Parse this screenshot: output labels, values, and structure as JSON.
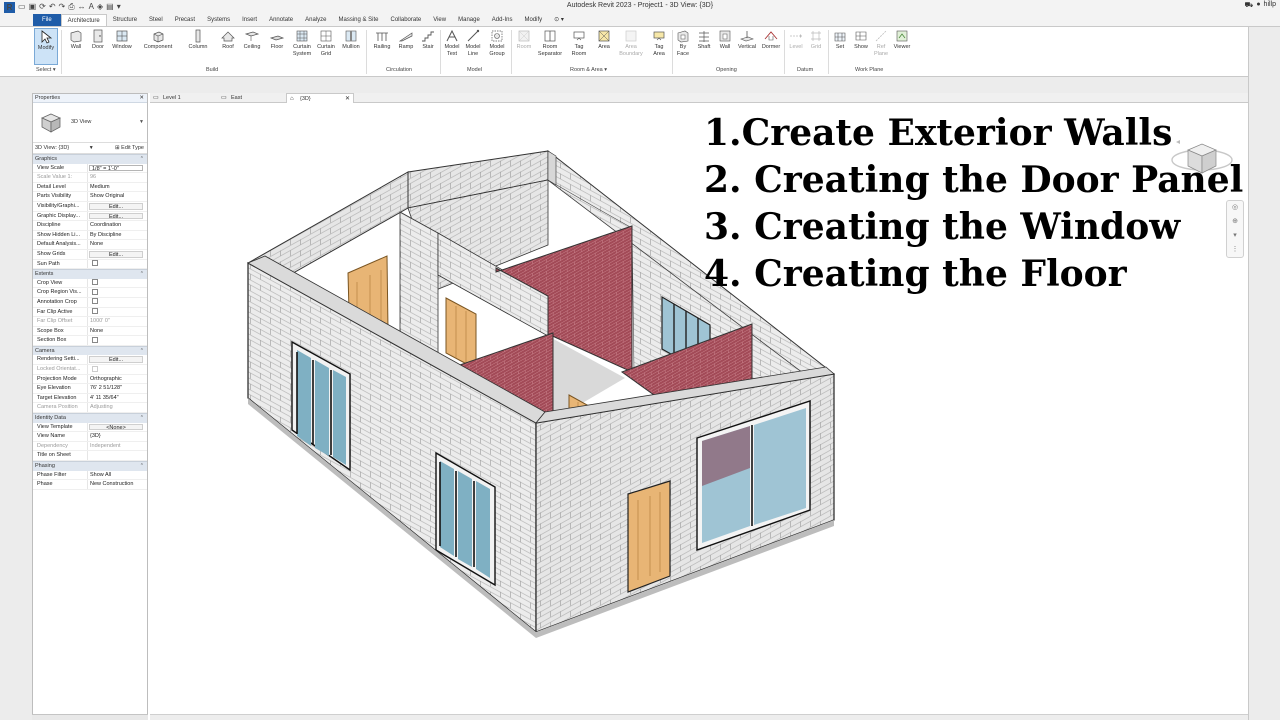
{
  "window": {
    "title": "Autodesk Revit 2023 - Project1 - 3D View: {3D}",
    "user": "hillp"
  },
  "tabs": [
    "File",
    "Architecture",
    "Structure",
    "Steel",
    "Precast",
    "Systems",
    "Insert",
    "Annotate",
    "Analyze",
    "Massing & Site",
    "Collaborate",
    "View",
    "Manage",
    "Add-Ins",
    "Modify"
  ],
  "ribbon": {
    "select": {
      "modify": "Modify",
      "label": "Select ▾"
    },
    "build": {
      "label": "Build",
      "wall": "Wall",
      "door": "Door",
      "window": "Window",
      "component": "Component",
      "column": "Column",
      "roof": "Roof",
      "ceiling": "Ceiling",
      "floor": "Floor",
      "curtain_system_1": "Curtain",
      "curtain_system_2": "System",
      "curtain_grid_1": "Curtain",
      "curtain_grid_2": "Grid",
      "mullion": "Mullion"
    },
    "circulation": {
      "label": "Circulation",
      "railing": "Railing",
      "ramp": "Ramp",
      "stair": "Stair"
    },
    "model": {
      "label": "Model",
      "model_text_1": "Model",
      "model_text_2": "Text",
      "model_line_1": "Model",
      "model_line_2": "Line",
      "model_group_1": "Model",
      "model_group_2": "Group"
    },
    "room_area": {
      "label": "Room & Area ▾",
      "room": "Room",
      "room_sep_1": "Room",
      "room_sep_2": "Separator",
      "tag_room_1": "Tag",
      "tag_room_2": "Room",
      "area": "Area",
      "area_boundary_1": "Area",
      "area_boundary_2": "Boundary",
      "tag_area_1": "Tag",
      "tag_area_2": "Area"
    },
    "opening": {
      "label": "Opening",
      "by_face_1": "By",
      "by_face_2": "Face",
      "shaft": "Shaft",
      "wall": "Wall",
      "vertical": "Vertical",
      "dormer": "Dormer"
    },
    "datum": {
      "label": "Datum",
      "level": "Level",
      "grid": "Grid"
    },
    "work_plane": {
      "label": "Work Plane",
      "set": "Set",
      "show": "Show",
      "ref_plane_1": "Ref",
      "ref_plane_2": "Plane",
      "viewer": "Viewer"
    }
  },
  "properties": {
    "title": "Properties",
    "type_name": "3D View",
    "filter": "3D View: {3D}",
    "edit_type": "Edit Type",
    "groups": {
      "graphics": "Graphics",
      "extents": "Extents",
      "camera": "Camera",
      "identity": "Identity Data",
      "phasing": "Phasing"
    },
    "rows": {
      "view_scale": [
        "View Scale",
        "1/8\" = 1'-0\""
      ],
      "scale_value": [
        "Scale Value    1:",
        "96"
      ],
      "detail_level": [
        "Detail Level",
        "Medium"
      ],
      "parts_visibility": [
        "Parts Visibility",
        "Show Original"
      ],
      "visibility_graphics": [
        "Visibility/Graphi...",
        "Edit..."
      ],
      "graphic_display": [
        "Graphic Display...",
        "Edit..."
      ],
      "discipline": [
        "Discipline",
        "Coordination"
      ],
      "show_hidden": [
        "Show Hidden Li...",
        "By Discipline"
      ],
      "default_analysis": [
        "Default Analysis...",
        "None"
      ],
      "show_grids": [
        "Show Grids",
        "Edit..."
      ],
      "sun_path": [
        "Sun Path",
        ""
      ],
      "crop_view": [
        "Crop View",
        ""
      ],
      "crop_region": [
        "Crop Region Vis...",
        ""
      ],
      "annotation_crop": [
        "Annotation Crop",
        ""
      ],
      "far_clip_active": [
        "Far Clip Active",
        ""
      ],
      "far_clip_offset": [
        "Far Clip Offset",
        "1000'  0\""
      ],
      "scope_box": [
        "Scope Box",
        "None"
      ],
      "section_box": [
        "Section Box",
        ""
      ],
      "rendering": [
        "Rendering Setti...",
        "Edit..."
      ],
      "locked_orient": [
        "Locked Orientat...",
        ""
      ],
      "projection": [
        "Projection Mode",
        "Orthographic"
      ],
      "eye_elevation": [
        "Eye Elevation",
        "76'  2 51/128\""
      ],
      "target_elevation": [
        "Target Elevation",
        "4'  11 35/64\""
      ],
      "camera_position": [
        "Camera Position",
        "Adjusting"
      ],
      "view_template": [
        "View Template",
        "<None>"
      ],
      "view_name": [
        "View Name",
        "{3D}"
      ],
      "dependency": [
        "Dependency",
        "Independent"
      ],
      "title_on_sheet": [
        "Title on Sheet",
        ""
      ],
      "phase_filter": [
        "Phase Filter",
        "Show All"
      ],
      "phase": [
        "Phase",
        "New Construction"
      ]
    }
  },
  "view_tabs": {
    "level1": "Level 1",
    "east": "East",
    "threed": "{3D}"
  },
  "overlay_lines": [
    "1.Create Exterior Walls",
    "2. Creating the Door Panel",
    "3. Creating the Window",
    "4.  Creating the Floor"
  ],
  "colors": {
    "accent": "#1f5ca8",
    "block_wall": "#ececec",
    "brick_wall": "#9c4552",
    "door": "#e8b575",
    "glass": "#9fc4d4"
  }
}
